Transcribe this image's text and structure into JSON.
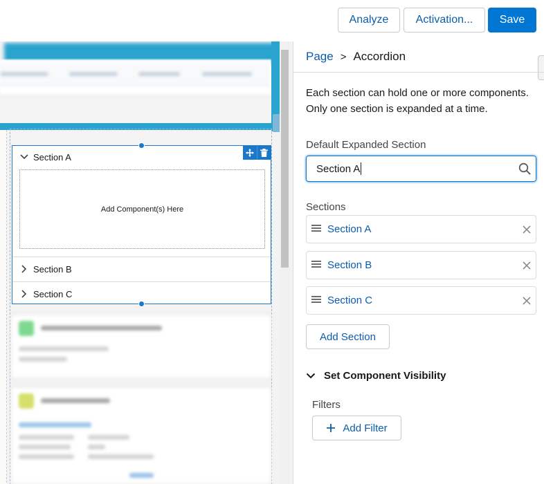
{
  "toolbar": {
    "analyze_label": "Analyze",
    "activation_label": "Activation...",
    "save_label": "Save"
  },
  "canvas": {
    "accordion": {
      "sections": [
        {
          "label": "Section A",
          "expanded": true
        },
        {
          "label": "Section B",
          "expanded": false
        },
        {
          "label": "Section C",
          "expanded": false
        }
      ],
      "drop_zone_text": "Add Component(s) Here"
    }
  },
  "panel": {
    "breadcrumb": {
      "parent": "Page",
      "separator": ">",
      "current": "Accordion"
    },
    "description": "Each section can hold one or more components. Only one section is expanded at a time.",
    "default_expanded": {
      "label": "Default Expanded Section",
      "value": "Section A"
    },
    "sections": {
      "label": "Sections",
      "items": [
        "Section A",
        "Section B",
        "Section C"
      ]
    },
    "add_section_label": "Add Section",
    "visibility": {
      "title": "Set Component Visibility",
      "filters_label": "Filters",
      "add_filter_label": "Add Filter"
    }
  },
  "colors": {
    "brand": "#0176d3",
    "link": "#0b5cab",
    "selection": "#1b77c7",
    "header_band": "#2ba3cf"
  }
}
